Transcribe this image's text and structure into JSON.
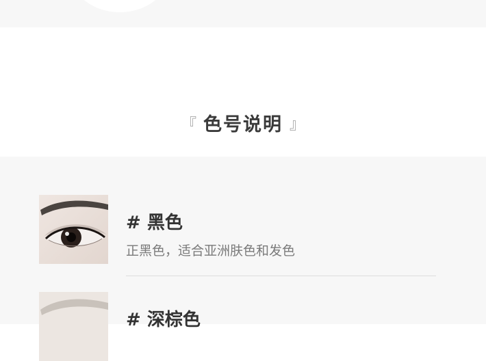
{
  "section": {
    "bracket_left": "『",
    "title": "色号说明",
    "bracket_right": "』"
  },
  "shades": [
    {
      "name": "# 黑色",
      "description": "正黑色，适合亚洲肤色和发色",
      "thumbnail_icon": "eye-brow-black-swatch"
    },
    {
      "name": "# 深棕色",
      "description": "",
      "thumbnail_icon": "eye-brow-dark-brown-swatch"
    }
  ],
  "colors": {
    "background_light": "#f7f7f7",
    "title_text": "#3a3a3a",
    "name_text": "#333333",
    "desc_text": "#7a7a7a",
    "divider": "#dddddd"
  }
}
